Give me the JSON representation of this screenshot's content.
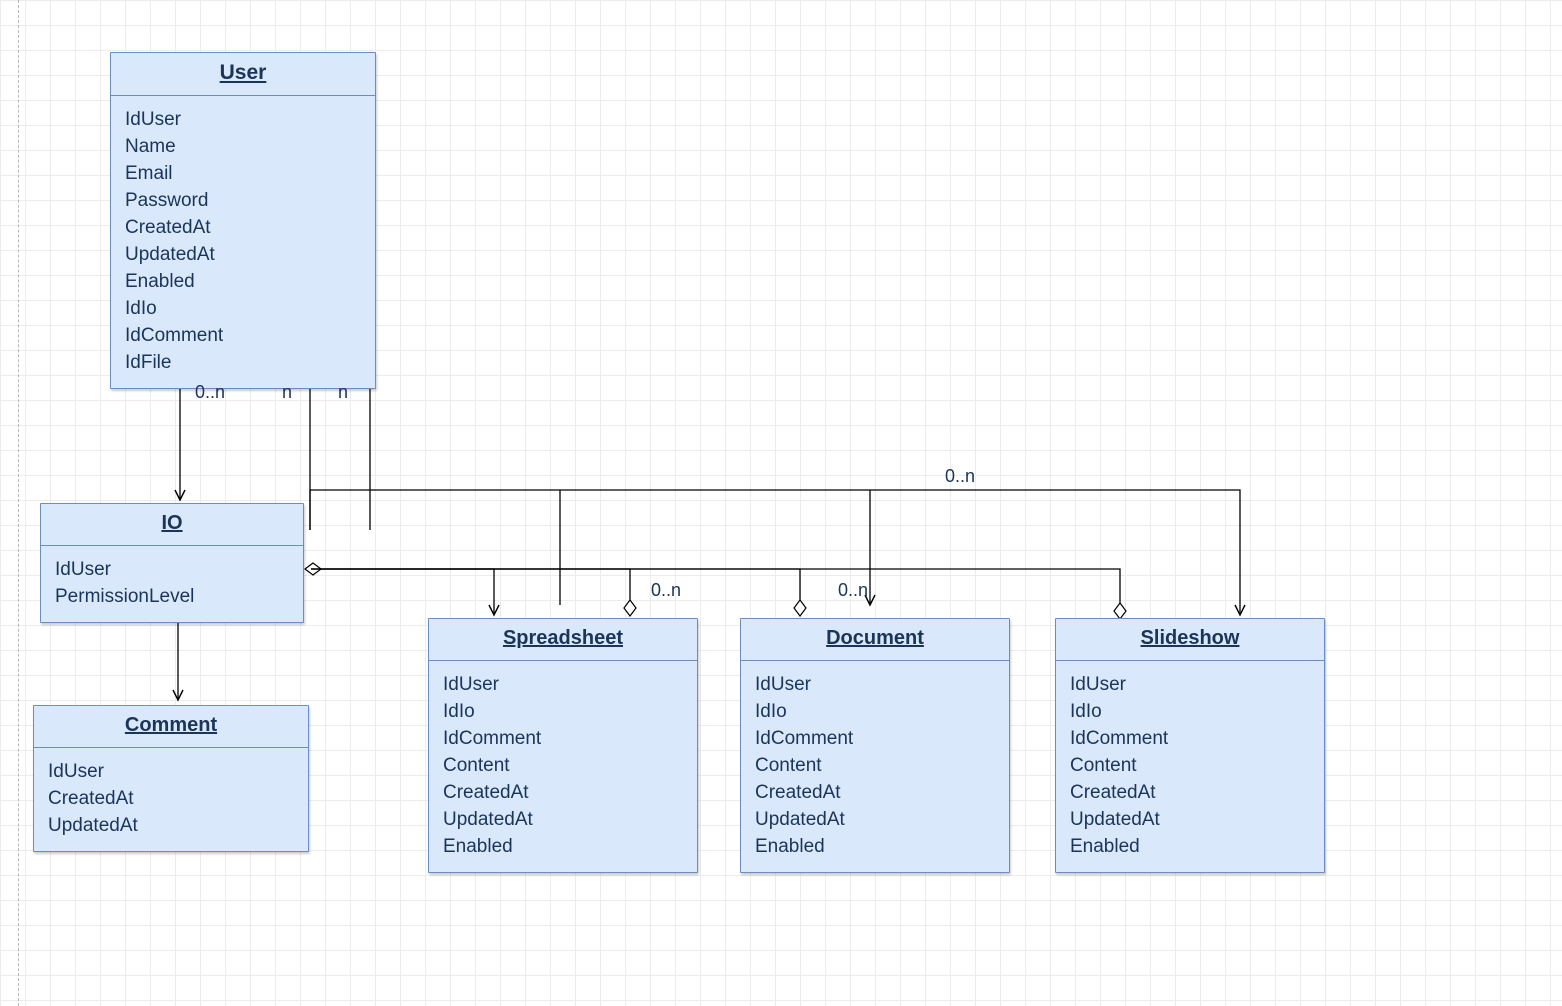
{
  "entities": {
    "user": {
      "title": "User",
      "attributes": [
        "IdUser",
        "Name",
        "Email",
        "Password",
        "CreatedAt",
        "UpdatedAt",
        "Enabled",
        "IdIo",
        "IdComment",
        "IdFile"
      ]
    },
    "io": {
      "title": "IO",
      "attributes": [
        "IdUser",
        "PermissionLevel"
      ]
    },
    "comment": {
      "title": "Comment",
      "attributes": [
        "IdUser",
        "CreatedAt",
        "UpdatedAt"
      ]
    },
    "spreadsheet": {
      "title": "Spreadsheet",
      "attributes": [
        "IdUser",
        "IdIo",
        "IdComment",
        "Content",
        "CreatedAt",
        "UpdatedAt",
        "Enabled"
      ]
    },
    "document": {
      "title": "Document",
      "attributes": [
        "IdUser",
        "IdIo",
        "IdComment",
        "Content",
        "CreatedAt",
        "UpdatedAt",
        "Enabled"
      ]
    },
    "slideshow": {
      "title": "Slideshow",
      "attributes": [
        "IdUser",
        "IdIo",
        "IdComment",
        "Content",
        "CreatedAt",
        "UpdatedAt",
        "Enabled"
      ]
    }
  },
  "multiplicities": {
    "user_io": "0..n",
    "user_n1": "n",
    "user_n2": "n",
    "top_right": "0..n",
    "spreadsheet": "0..n",
    "document": "0..n"
  },
  "colors": {
    "boxFill": "#dae8fc",
    "boxStroke": "#6c8ebf",
    "text": "#1a3558",
    "line": "#000000"
  }
}
